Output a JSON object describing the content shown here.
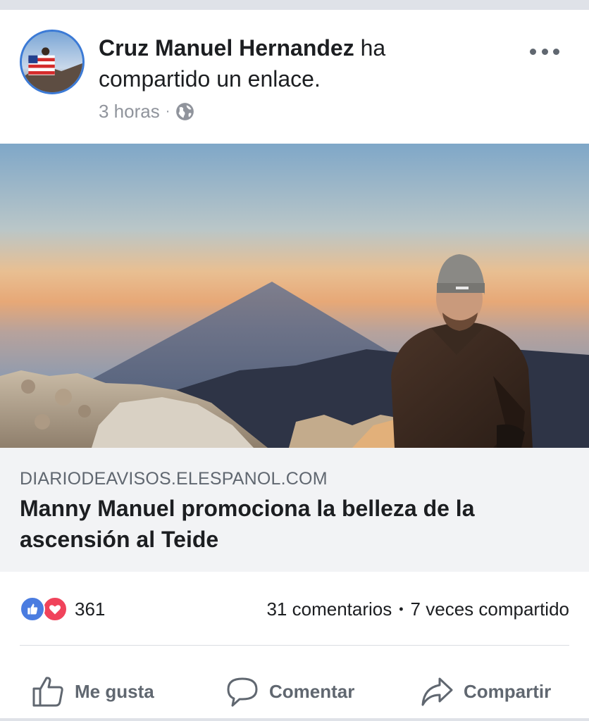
{
  "post": {
    "author": "Cruz Manuel Hernandez",
    "action_text": " ha compartido un enlace.",
    "time": "3 horas",
    "separator": "·",
    "privacy_icon": "globe-icon",
    "more_icon": "more-options-icon"
  },
  "link": {
    "domain": "DIARIODEAVISOS.ELESPANOL.COM",
    "title": "Manny Manuel promociona la belleza de la ascensión al Teide"
  },
  "stats": {
    "reaction_icons": [
      "like-reaction-icon",
      "love-reaction-icon"
    ],
    "reaction_count": "361",
    "comments": "31 comentarios",
    "separator": "•",
    "shares": "7 veces compartido"
  },
  "actions": {
    "like_label": "Me gusta",
    "comment_label": "Comentar",
    "share_label": "Compartir"
  },
  "colors": {
    "like_blue": "#4a7ce0",
    "love_red": "#f0435b",
    "avatar_ring": "#3b7ad6",
    "caption_bg": "#f2f3f5",
    "meta_gray": "#90949c"
  }
}
